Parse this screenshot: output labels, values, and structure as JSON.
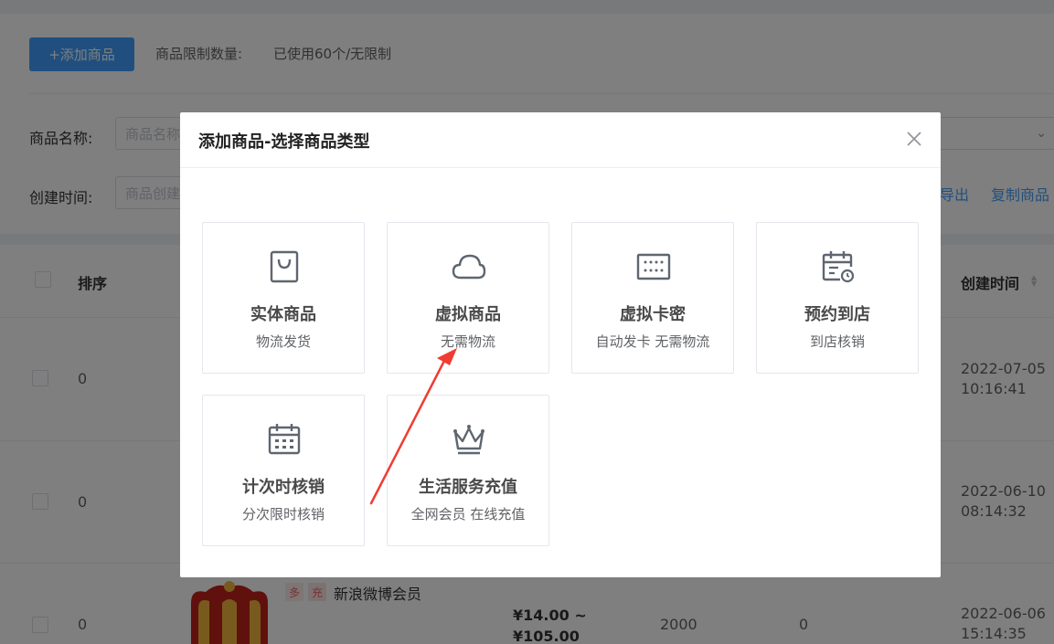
{
  "page": {
    "add_button": "+添加商品",
    "limit_label": "商品限制数量:",
    "limit_value": "已使用60个/无限制",
    "filters": {
      "name_label": "商品名称:",
      "name_placeholder": "商品名称",
      "created_label": "创建时间:",
      "created_placeholder": "商品创建"
    },
    "links": {
      "export": "导出",
      "copy": "复制商品"
    },
    "table": {
      "col_sort": "排序",
      "col_created": "创建时间",
      "rows": [
        {
          "sort": "0",
          "date": "2022-07-05",
          "time": "10:16:41"
        },
        {
          "sort": "0",
          "date": "2022-06-10",
          "time": "08:14:32"
        },
        {
          "sort": "0",
          "tag1": "多",
          "tag2": "充",
          "name": "新浪微博会员",
          "price_min": "¥14.00 ~",
          "price_max": "¥105.00",
          "stock": "2000",
          "sales": "0",
          "date": "2022-06-06",
          "time": "15:14:35"
        }
      ]
    }
  },
  "modal": {
    "title": "添加商品-选择商品类型",
    "close_icon": "close-icon",
    "types": [
      {
        "name": "实体商品",
        "desc": "物流发货",
        "icon": "shopping-bag-icon"
      },
      {
        "name": "虚拟商品",
        "desc": "无需物流",
        "icon": "cloud-icon"
      },
      {
        "name": "虚拟卡密",
        "desc": "自动发卡 无需物流",
        "icon": "keypad-icon"
      },
      {
        "name": "预约到店",
        "desc": "到店核销",
        "icon": "calendar-clock-icon"
      },
      {
        "name": "计次时核销",
        "desc": "分次限时核销",
        "icon": "calendar-icon"
      },
      {
        "name": "生活服务充值",
        "desc": "全网会员 在线充值",
        "icon": "crown-icon"
      }
    ]
  },
  "colors": {
    "accent": "#409eff",
    "annotation_arrow": "#f03c32",
    "overlay": "rgba(0,0,0,0.5)"
  }
}
